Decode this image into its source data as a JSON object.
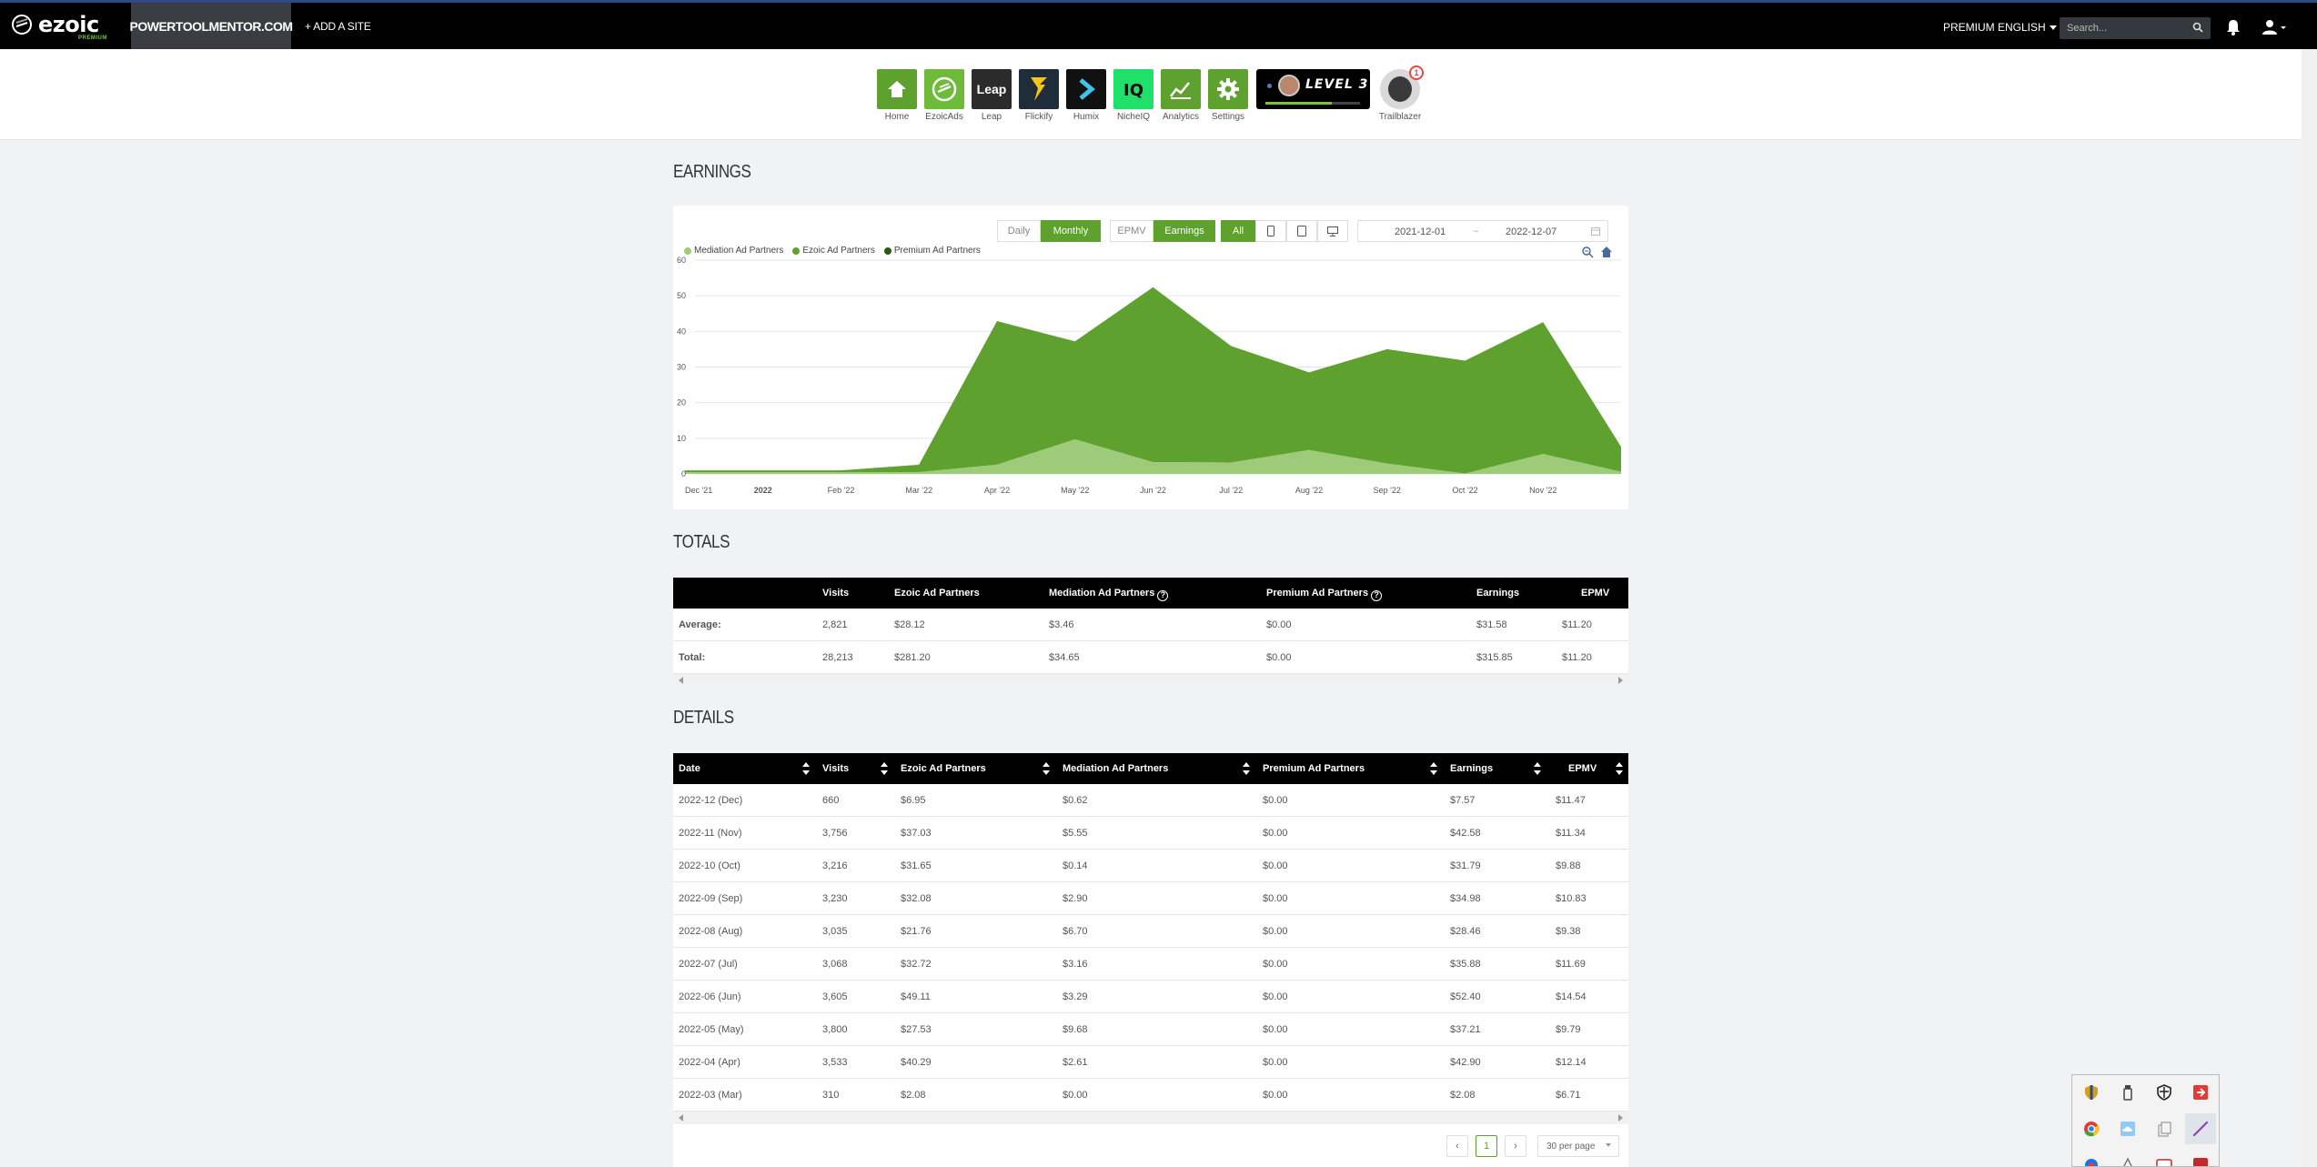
{
  "nav": {
    "logo_text": "ezoic",
    "logo_sub": "PREMIUM",
    "site": "POWERTOOLMENTOR.COM",
    "add_site": "+ ADD A SITE",
    "premium": "PREMIUM",
    "language": "ENGLISH",
    "search_placeholder": "Search..."
  },
  "apps": [
    {
      "label": "Home",
      "icon": "house-icon",
      "color": "#5fa12f"
    },
    {
      "label": "EzoicAds",
      "icon": "ezoic-ads-icon",
      "color": "#6dbb38"
    },
    {
      "label": "Leap",
      "icon": "leap-icon",
      "color": "#2b2b2b"
    },
    {
      "label": "Flickify",
      "icon": "flickify-icon",
      "color": "#1f2d3a"
    },
    {
      "label": "Humix",
      "icon": "humix-icon",
      "color": "#111111"
    },
    {
      "label": "NicheIQ",
      "icon": "nicheiq-icon",
      "color": "#1fe06a"
    },
    {
      "label": "Analytics",
      "icon": "analytics-icon",
      "color": "#5fa12f"
    },
    {
      "label": "Settings",
      "icon": "gear-icon",
      "color": "#5fa12f"
    }
  ],
  "level": {
    "text": "LEVEL 3",
    "progress": 0.7
  },
  "trailblazer": {
    "label": "Trailblazer",
    "badge": "1"
  },
  "earnings": {
    "heading": "EARNINGS",
    "granularity": [
      "Daily",
      "Monthly"
    ],
    "granularity_selected": "Monthly",
    "metric": [
      "EPMV",
      "Earnings"
    ],
    "metric_selected": "Earnings",
    "device_all": "All",
    "date_start": "2021-12-01",
    "date_sep": "~",
    "date_end": "2022-12-07"
  },
  "chart_data": {
    "type": "area",
    "x": [
      "Dec '21",
      "2022",
      "Feb '22",
      "Mar '22",
      "Apr '22",
      "May '22",
      "Jun '22",
      "Jul '22",
      "Aug '22",
      "Sep '22",
      "Oct '22",
      "Nov '22",
      ""
    ],
    "x_tick_labels": [
      "Dec '21",
      "2022",
      "Feb '22",
      "Mar '22",
      "Apr '22",
      "May '22",
      "Jun '22",
      "Jul '22",
      "Aug '22",
      "Sep '22",
      "Oct '22",
      "Nov '22"
    ],
    "y_ticks": [
      0,
      10,
      20,
      30,
      40,
      50,
      60
    ],
    "ylim": [
      0,
      60
    ],
    "stacked": true,
    "legend_position": "top-left",
    "series": [
      {
        "name": "Mediation Ad Partners",
        "color": "#9dcb79",
        "values": [
          0.5,
          0.5,
          0.5,
          0.5,
          2.6,
          9.7,
          3.3,
          3.2,
          6.7,
          2.9,
          0.1,
          5.6,
          0.6
        ]
      },
      {
        "name": "Ezoic Ad Partners",
        "color": "#5fa12f",
        "values": [
          0.5,
          0.5,
          0.5,
          2.1,
          40.3,
          27.5,
          49.1,
          32.7,
          21.8,
          32.1,
          31.7,
          37.0,
          7.0
        ]
      },
      {
        "name": "Premium Ad Partners",
        "color": "#2f5a12",
        "values": [
          0,
          0,
          0,
          0,
          0,
          0,
          0,
          0,
          0,
          0,
          0,
          0,
          0
        ]
      }
    ]
  },
  "totals": {
    "heading": "TOTALS",
    "columns": [
      "Visits",
      "Ezoic Ad Partners",
      "Mediation Ad Partners",
      "Premium Ad Partners",
      "Earnings",
      "EPMV"
    ],
    "rows": [
      {
        "label": "Average:",
        "cells": [
          "2,821",
          "$28.12",
          "$3.46",
          "$0.00",
          "$31.58",
          "$11.20"
        ]
      },
      {
        "label": "Total:",
        "cells": [
          "28,213",
          "$281.20",
          "$34.65",
          "$0.00",
          "$315.85",
          "$11.20"
        ]
      }
    ]
  },
  "details": {
    "heading": "DETAILS",
    "columns": [
      "Date",
      "Visits",
      "Ezoic Ad Partners",
      "Mediation Ad Partners",
      "Premium Ad Partners",
      "Earnings",
      "EPMV"
    ],
    "rows": [
      [
        "2022-12 (Dec)",
        "660",
        "$6.95",
        "$0.62",
        "$0.00",
        "$7.57",
        "$11.47"
      ],
      [
        "2022-11 (Nov)",
        "3,756",
        "$37.03",
        "$5.55",
        "$0.00",
        "$42.58",
        "$11.34"
      ],
      [
        "2022-10 (Oct)",
        "3,216",
        "$31.65",
        "$0.14",
        "$0.00",
        "$31.79",
        "$9.88"
      ],
      [
        "2022-09 (Sep)",
        "3,230",
        "$32.08",
        "$2.90",
        "$0.00",
        "$34.98",
        "$10.83"
      ],
      [
        "2022-08 (Aug)",
        "3,035",
        "$21.76",
        "$6.70",
        "$0.00",
        "$28.46",
        "$9.38"
      ],
      [
        "2022-07 (Jul)",
        "3,068",
        "$32.72",
        "$3.16",
        "$0.00",
        "$35.88",
        "$11.69"
      ],
      [
        "2022-06 (Jun)",
        "3,605",
        "$49.11",
        "$3.29",
        "$0.00",
        "$52.40",
        "$14.54"
      ],
      [
        "2022-05 (May)",
        "3,800",
        "$27.53",
        "$9.68",
        "$0.00",
        "$37.21",
        "$9.79"
      ],
      [
        "2022-04 (Apr)",
        "3,533",
        "$40.29",
        "$2.61",
        "$0.00",
        "$42.90",
        "$12.14"
      ],
      [
        "2022-03 (Mar)",
        "310",
        "$2.08",
        "$0.00",
        "$0.00",
        "$2.08",
        "$6.71"
      ]
    ]
  },
  "pager": {
    "prev": "‹",
    "page": "1",
    "next": "›",
    "per_page": "30 per page"
  },
  "tray": {
    "icons": [
      "shield-icon",
      "usb-icon",
      "security-icon",
      "red-app-icon",
      "chrome-icon",
      "cloud-icon",
      "copy-icon",
      "pen-icon",
      "app-icon",
      "app-icon",
      "app-icon",
      "acrobat-icon"
    ]
  }
}
